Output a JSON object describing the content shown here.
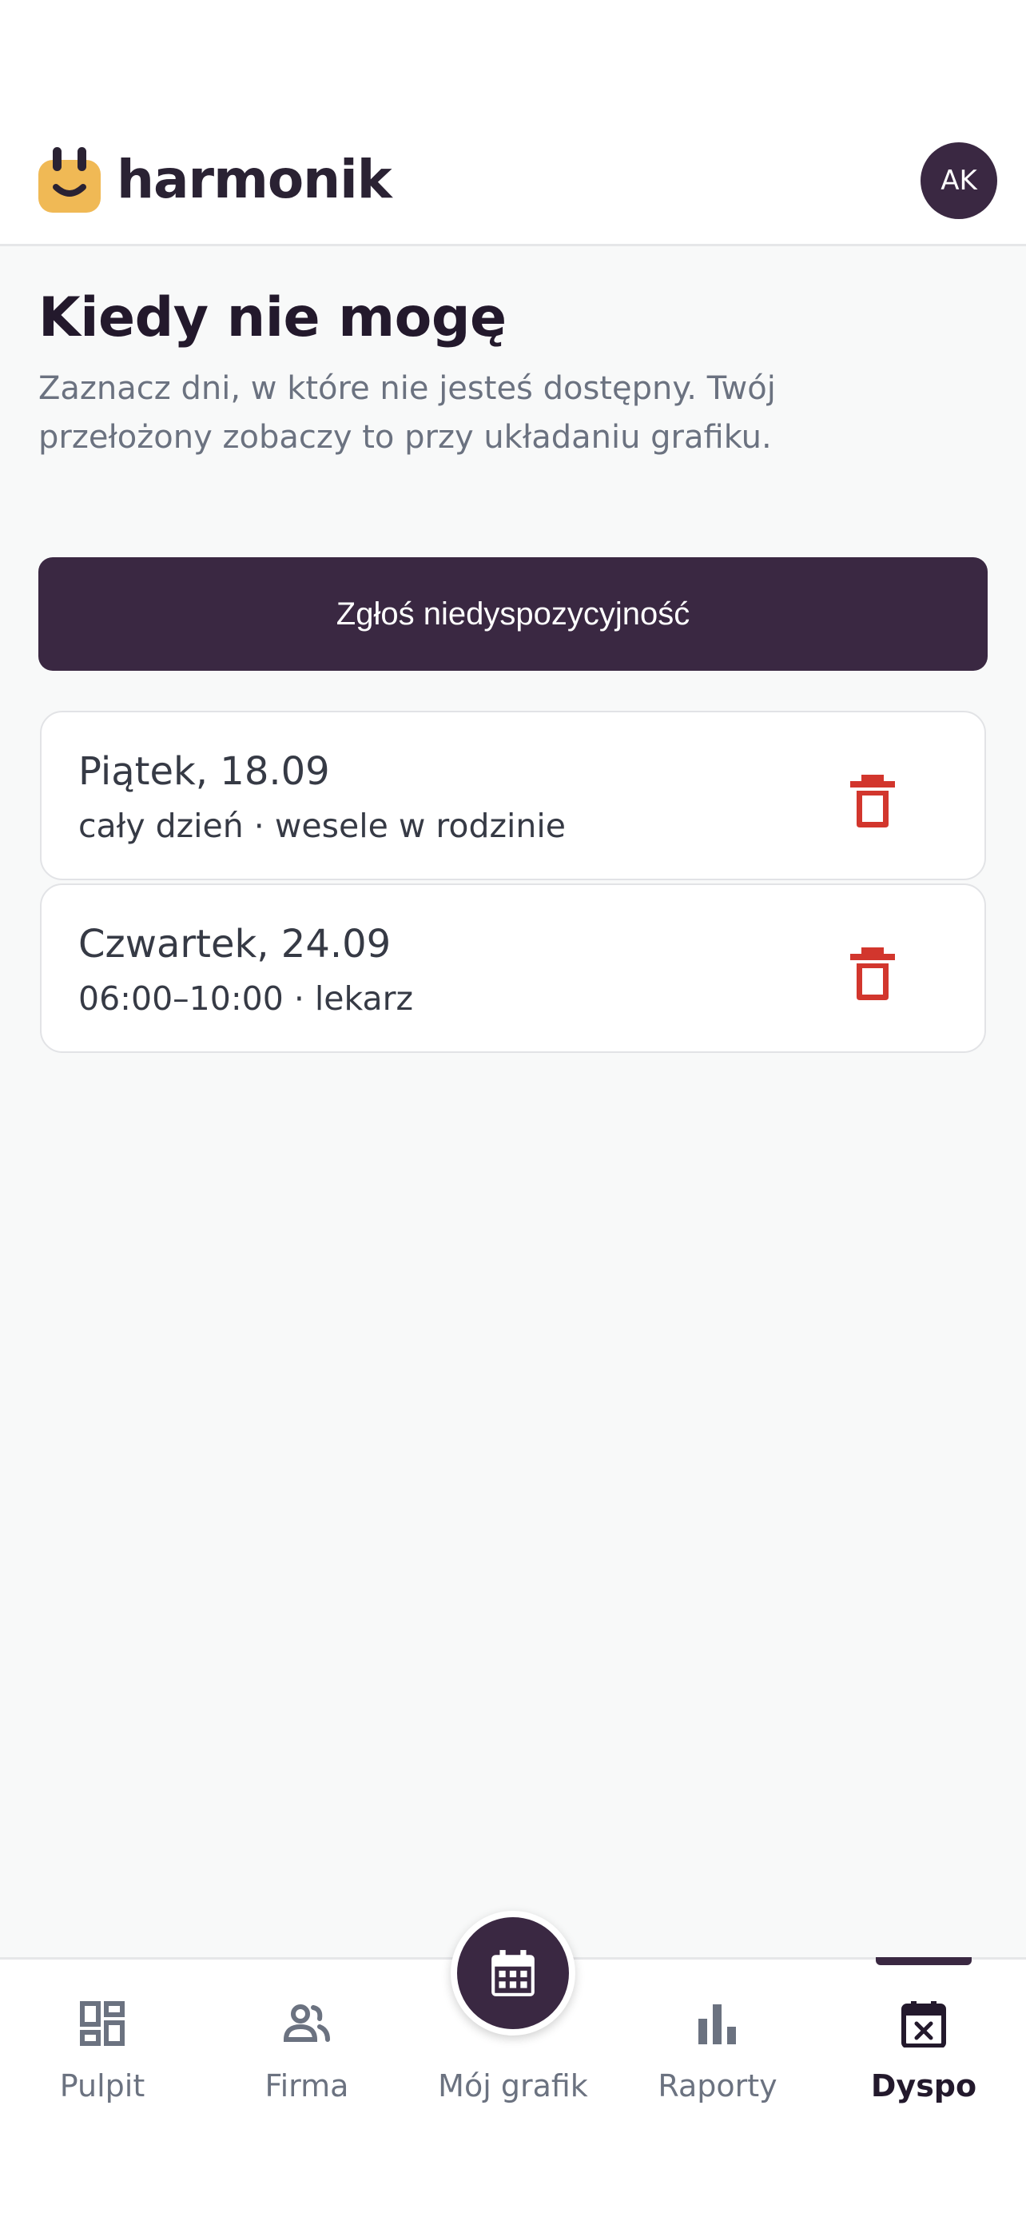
{
  "app": {
    "name": "harmonik"
  },
  "user": {
    "initials": "AK"
  },
  "page": {
    "title": "Kiedy nie mogę",
    "subtitle": "Zaznacz dni, w które nie jesteś dostępny. Twój przełożony zobaczy to przy układaniu grafiku."
  },
  "actions": {
    "report_label": "Zgłoś niedyspozycyjność"
  },
  "entries": [
    {
      "date": "Piątek, 18.09",
      "detail": "cały dzień · wesele w rodzinie"
    },
    {
      "date": "Czwartek, 24.09",
      "detail": "06:00–10:00 · lekarz"
    }
  ],
  "nav": {
    "items": [
      {
        "label": "Pulpit",
        "icon": "dashboard-icon"
      },
      {
        "label": "Firma",
        "icon": "people-icon"
      },
      {
        "label": "Mój grafik",
        "icon": "calendar-icon"
      },
      {
        "label": "Raporty",
        "icon": "bar-chart-icon"
      },
      {
        "label": "Dyspo",
        "icon": "calendar-x-icon",
        "active": true
      }
    ]
  },
  "colors": {
    "primary": "#3a2842",
    "accent": "#f0b955",
    "danger": "#d2362d",
    "muted": "#6b7280"
  }
}
